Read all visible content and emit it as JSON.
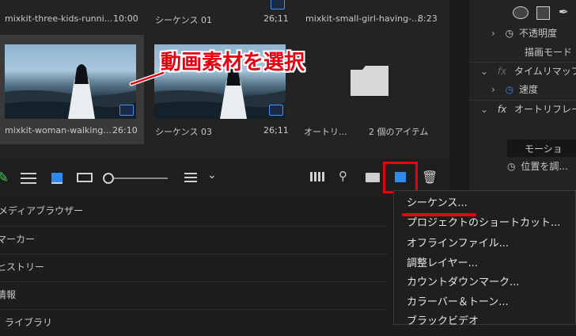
{
  "bin": {
    "top_row": [
      {
        "name": "mixkit-three-kids-runni...",
        "duration": "10:00"
      },
      {
        "name": "シーケンス 01",
        "duration": "26;11"
      },
      {
        "name": "mixkit-small-girl-having-...",
        "duration": "8:23"
      }
    ],
    "middle_row": [
      {
        "name": "mixkit-woman-walking...",
        "duration": "26:10"
      },
      {
        "name": "シーケンス 03",
        "duration": "26;11"
      },
      {
        "name": "オートリ...",
        "duration": "2 個のアイテム"
      }
    ]
  },
  "annotation": {
    "callout": "動画素材を選択"
  },
  "effect_controls": {
    "opacity": "不透明度",
    "blend_mode": "描画モード",
    "fx_time_remap": "タイムリマップ",
    "speed": "速度",
    "fx_auto_reframe": "オートリフレー",
    "motion": "モーショ",
    "position": "位置を調...",
    "fx_label": "fx"
  },
  "panels": [
    "メディアブラウザー",
    "マーカー",
    "ヒストリー",
    "情報",
    "ライブラリ"
  ],
  "context_menu": {
    "items": [
      "シーケンス...",
      "プロジェクトのショートカット...",
      "オフラインファイル...",
      "調整レイヤー...",
      "カウントダウンマーク...",
      "カラーバー＆トーン...",
      "ブラックビデオ"
    ]
  },
  "colors": {
    "highlight": "#e60012",
    "accent": "#2d8ceb",
    "background": "#1d1d1d"
  }
}
